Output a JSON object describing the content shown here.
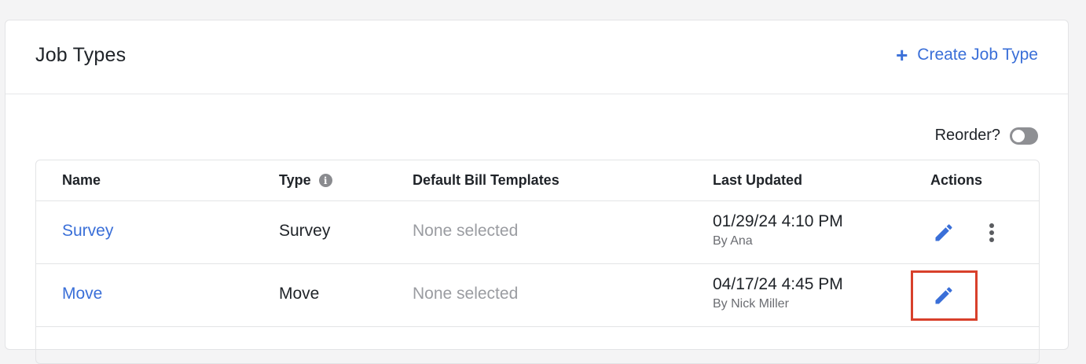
{
  "header": {
    "title": "Job Types",
    "create_label": "Create Job Type",
    "create_icon": "plus-icon"
  },
  "reorder": {
    "label": "Reorder?",
    "enabled": false
  },
  "table": {
    "columns": {
      "name": "Name",
      "type": "Type",
      "bill_templates": "Default Bill Templates",
      "last_updated": "Last Updated",
      "actions": "Actions"
    },
    "rows": [
      {
        "name": "Survey",
        "type": "Survey",
        "bill_templates": "None selected",
        "updated_when": "01/29/24 4:10 PM",
        "updated_by": "By Ana"
      },
      {
        "name": "Move",
        "type": "Move",
        "bill_templates": "None selected",
        "updated_when": "04/17/24 4:45 PM",
        "updated_by": "By Nick Miller"
      }
    ]
  },
  "colors": {
    "accent": "#3a6fd8",
    "highlight": "#d8402b"
  }
}
